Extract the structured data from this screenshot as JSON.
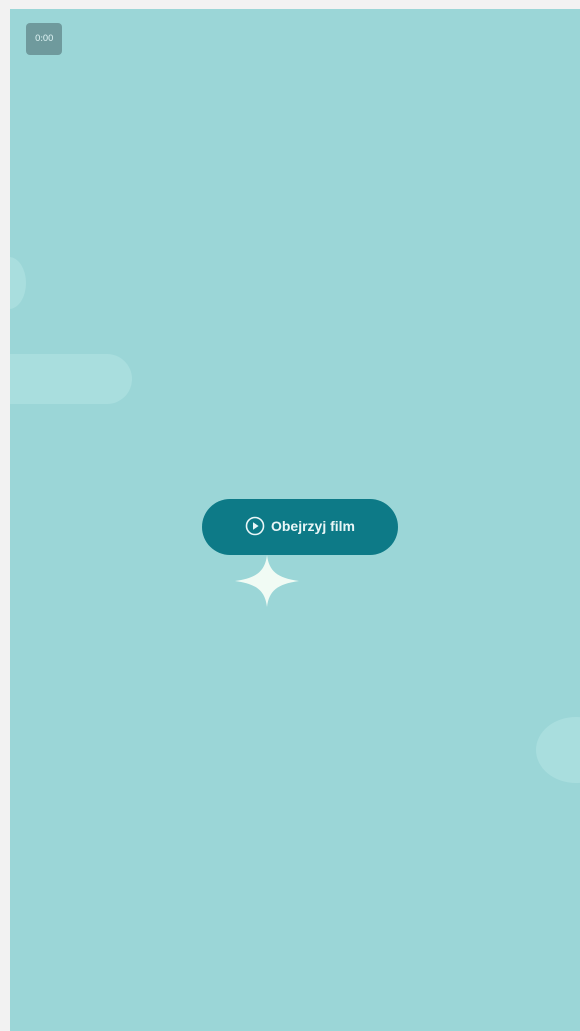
{
  "status": {
    "badge_text": "0:00"
  },
  "main": {
    "watch_button_label": "Obejrzyj film",
    "watch_button_icon": "play-circle-icon",
    "decoration_icon": "sparkle-icon"
  },
  "colors": {
    "background": "#9bd6d7",
    "button": "#0d7a87",
    "button_text": "#e9f6f7",
    "sparkle": "#f1fbf4"
  }
}
